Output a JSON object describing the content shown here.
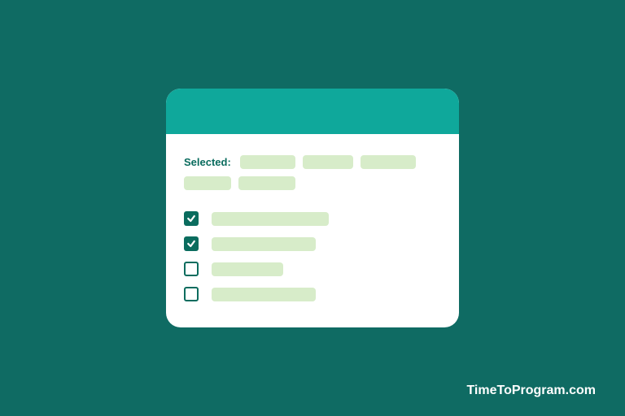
{
  "selected_label": "Selected:",
  "selected_chips": [
    {
      "id": "chip-1"
    },
    {
      "id": "chip-2"
    },
    {
      "id": "chip-3"
    },
    {
      "id": "chip-4"
    },
    {
      "id": "chip-5"
    }
  ],
  "options": [
    {
      "checked": true,
      "label_class": "opt-1"
    },
    {
      "checked": true,
      "label_class": "opt-2"
    },
    {
      "checked": false,
      "label_class": "opt-3"
    },
    {
      "checked": false,
      "label_class": "opt-4"
    }
  ],
  "watermark": "TimeToProgram.com",
  "colors": {
    "background": "#0f6b63",
    "header": "#0fa89b",
    "accent": "#0a6c5e",
    "chip": "#d7ecc9"
  }
}
